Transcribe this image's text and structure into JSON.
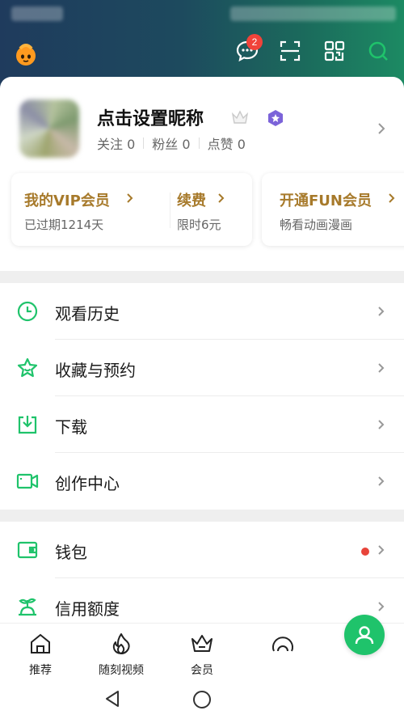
{
  "header": {
    "message_badge": "2",
    "colors": {
      "accent_green": "#1fc36b",
      "gold": "#a77a2b",
      "badge_red": "#f0433a"
    },
    "icons": [
      "mascot-logo-icon",
      "message-icon",
      "scan-icon",
      "qrcode-icon",
      "search-icon"
    ]
  },
  "profile": {
    "nickname": "点击设置昵称",
    "stats": [
      {
        "label": "关注",
        "value": "0"
      },
      {
        "label": "粉丝",
        "value": "0"
      },
      {
        "label": "点赞",
        "value": "0"
      }
    ]
  },
  "vip": {
    "my_vip": {
      "title": "我的VIP会员",
      "sub": "已过期1214天"
    },
    "renew": {
      "title": "续费",
      "sub": "限时6元"
    },
    "fun": {
      "title": "开通FUN会员",
      "sub": "畅看动画漫画"
    }
  },
  "menu": {
    "section1": [
      {
        "label": "观看历史",
        "icon": "clock-icon"
      },
      {
        "label": "收藏与预约",
        "icon": "star-icon"
      },
      {
        "label": "下载",
        "icon": "download-icon"
      },
      {
        "label": "创作中心",
        "icon": "video-camera-icon"
      }
    ],
    "section2": [
      {
        "label": "钱包",
        "icon": "wallet-icon"
      },
      {
        "label": "信用额度",
        "icon": "credit-icon"
      }
    ]
  },
  "bottom_nav": [
    {
      "label": "推荐",
      "icon": "home-icon"
    },
    {
      "label": "随刻视频",
      "icon": "flame-icon"
    },
    {
      "label": "会员",
      "icon": "crown-icon"
    },
    {
      "label": "",
      "icon": "circle-icon"
    }
  ]
}
